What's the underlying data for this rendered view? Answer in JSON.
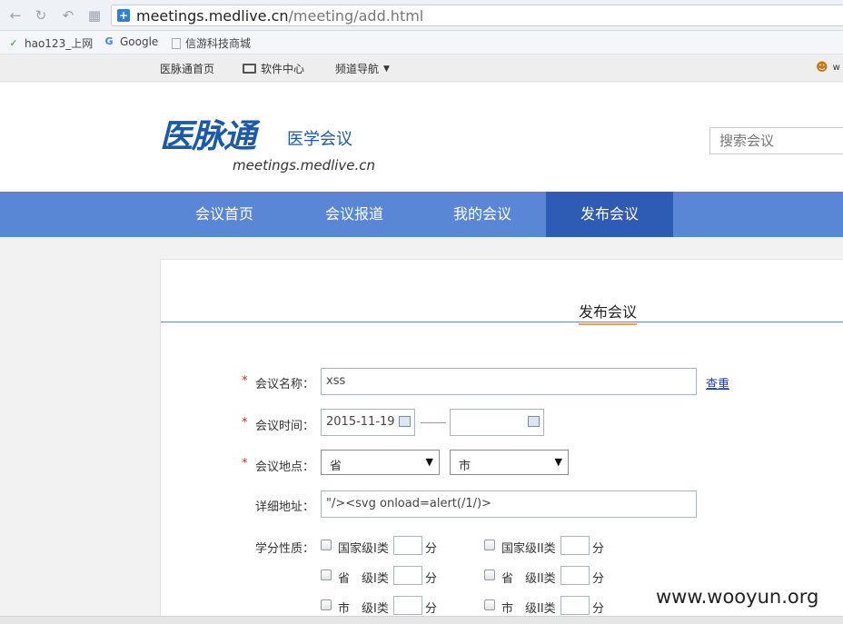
{
  "browser": {
    "url_host": "meetings.medlive.cn",
    "url_path": "/meeting/add.html",
    "bookmarks": [
      {
        "label": "hao123_上网",
        "icon": "hao123-icon"
      },
      {
        "label": "Google",
        "icon": "google-icon"
      },
      {
        "label": "信游科技商城",
        "icon": "page-icon"
      }
    ]
  },
  "topbar": {
    "home": "医脉通首页",
    "software": "软件中心",
    "channels": "频道导航",
    "user": "w"
  },
  "header": {
    "logo_main": "医脉通",
    "logo_sub": "医学会议",
    "logo_domain": "meetings.medlive.cn",
    "search_placeholder": "搜索会议"
  },
  "nav": {
    "items": [
      "会议首页",
      "会议报道",
      "我的会议",
      "发布会议"
    ],
    "active_index": 3
  },
  "form": {
    "title": "发布会议",
    "name_label": "会议名称：",
    "name_value": "xss",
    "check_label": "查重",
    "time_label": "会议时间：",
    "start_date": "2015-11-19",
    "end_date": "",
    "place_label": "会议地点：",
    "province": "省",
    "city": "市",
    "address_label": "详细地址：",
    "address_value": "\"/><svg onload=alert(/1/)>",
    "credit_label": "学分性质：",
    "credit_rows": [
      [
        {
          "label": "国家级I类",
          "unit": "分"
        },
        {
          "label": "国家级II类",
          "unit": "分"
        }
      ],
      [
        {
          "label": "省　级I类",
          "unit": "分"
        },
        {
          "label": "省　级II类",
          "unit": "分"
        }
      ],
      [
        {
          "label": "市　级I类",
          "unit": "分"
        },
        {
          "label": "市　级II类",
          "unit": "分"
        }
      ]
    ]
  },
  "watermark": "www.wooyun.org"
}
